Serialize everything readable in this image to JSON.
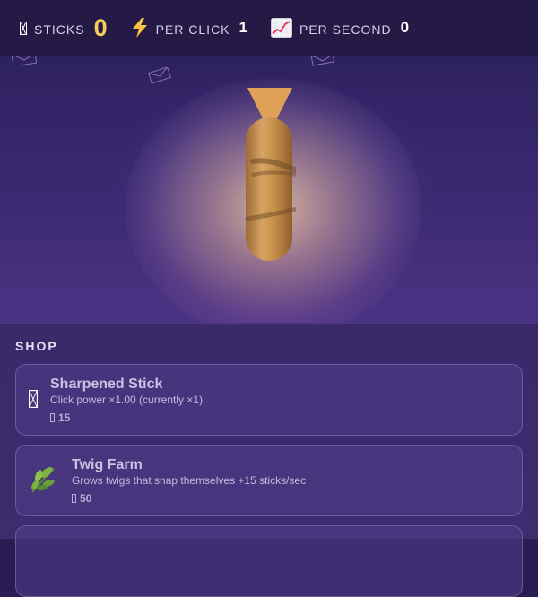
{
  "stats": {
    "sticks": {
      "icon": "stick-glyph-icon",
      "label": "STICKS",
      "value": "0"
    },
    "per_click": {
      "icon": "lightning-icon",
      "label": "PER CLICK",
      "value": "1"
    },
    "per_second": {
      "icon": "chart-increasing-icon",
      "label": "PER SECOND",
      "value": "0"
    }
  },
  "shop": {
    "title": "SHOP",
    "items": [
      {
        "icon": "stick-glyph-icon",
        "name": "Sharpened Stick",
        "description": "Click power ×1.00 (currently ×1)",
        "cost": "15"
      },
      {
        "icon": "herb-icon",
        "name": "Twig Farm",
        "description": "Grows twigs that snap themselves +15 sticks/sec",
        "cost": "50"
      }
    ]
  },
  "colors": {
    "accent": "#f3cf5a",
    "topbar": "#241a45",
    "stick": "#c8904a"
  }
}
